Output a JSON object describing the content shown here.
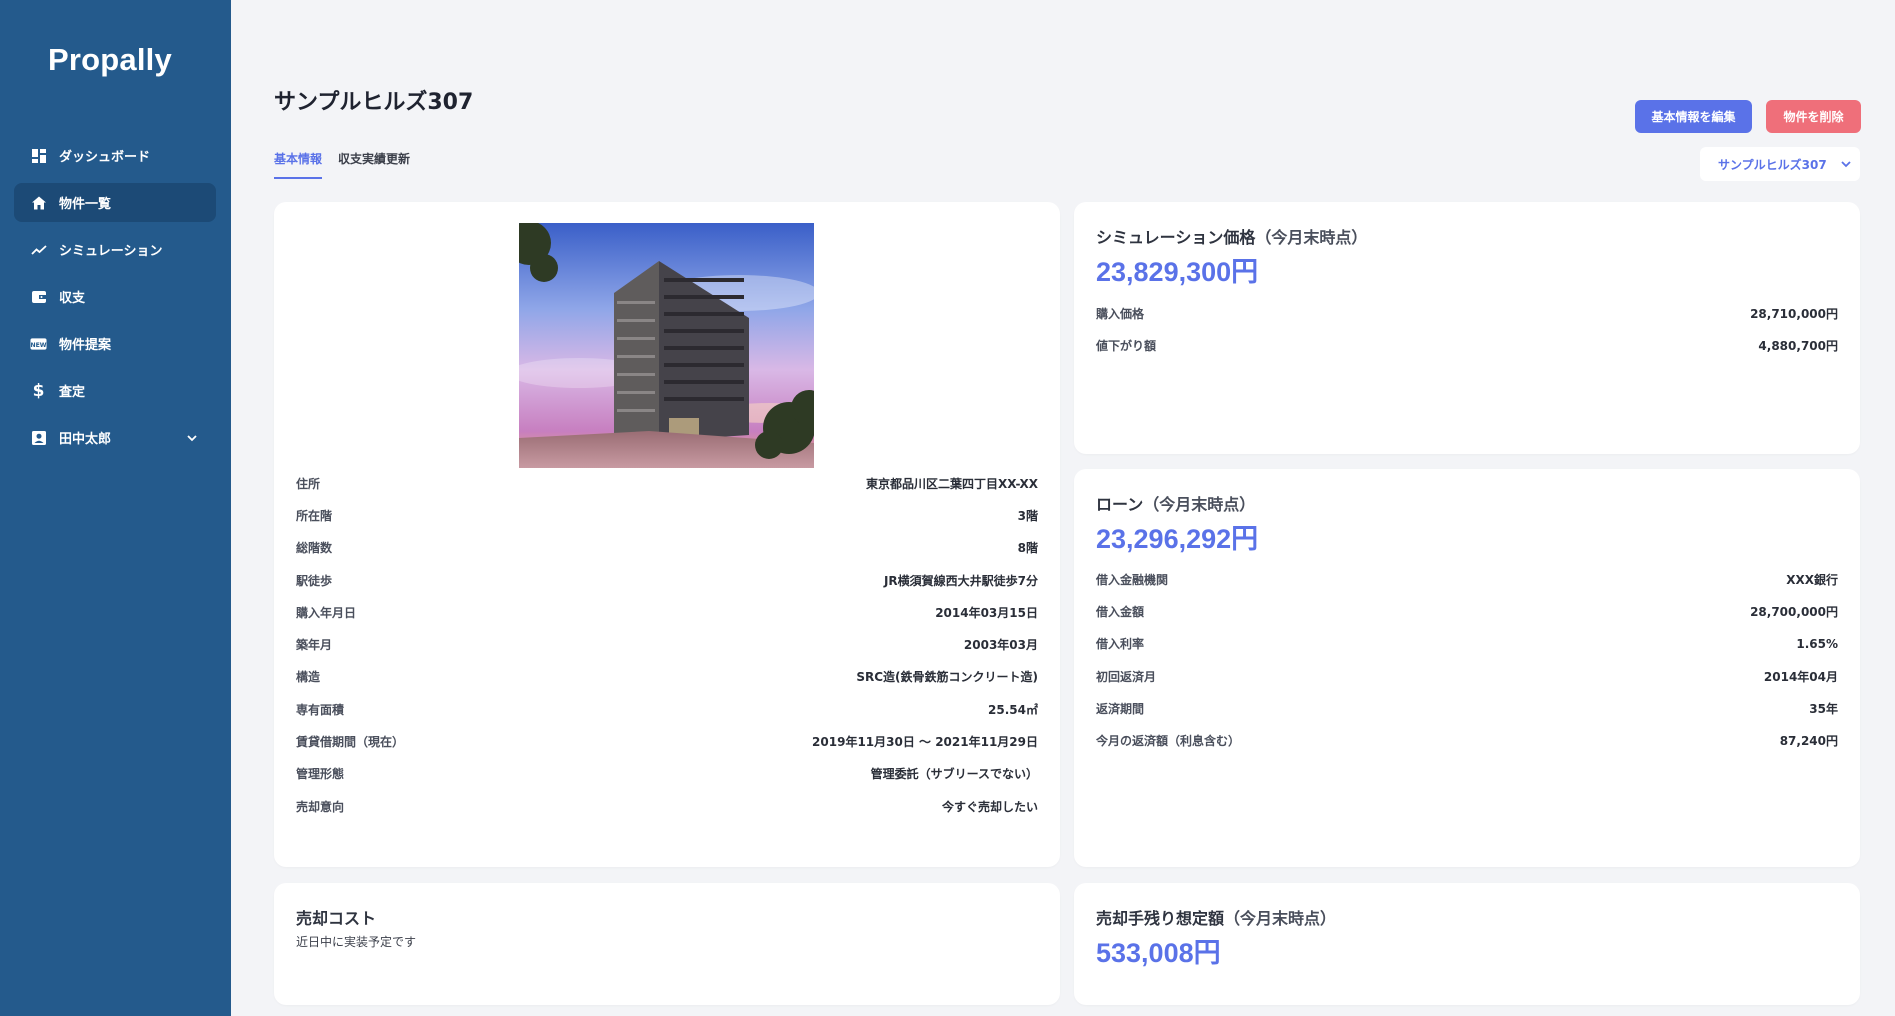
{
  "app": {
    "name": "Propally"
  },
  "sidebar": {
    "items": [
      {
        "label": "ダッシュボード"
      },
      {
        "label": "物件一覧"
      },
      {
        "label": "シミュレーション"
      },
      {
        "label": "収支"
      },
      {
        "label": "物件提案"
      },
      {
        "label": "査定"
      },
      {
        "label": "田中太郎"
      }
    ]
  },
  "page": {
    "title": "サンプルヒルズ307",
    "edit_button": "基本情報を編集",
    "delete_button": "物件を削除",
    "tabs": [
      {
        "label": "基本情報"
      },
      {
        "label": "収支実績更新"
      }
    ],
    "property_select": "サンプルヒルズ307"
  },
  "property": {
    "rows": [
      {
        "label": "住所",
        "value": "東京都品川区二葉四丁目XX-XX"
      },
      {
        "label": "所在階",
        "value": "3階"
      },
      {
        "label": "総階数",
        "value": "8階"
      },
      {
        "label": "駅徒歩",
        "value": "JR横須賀線西大井駅徒歩7分"
      },
      {
        "label": "購入年月日",
        "value": "2014年03月15日"
      },
      {
        "label": "築年月",
        "value": "2003年03月"
      },
      {
        "label": "構造",
        "value": "SRC造(鉄骨鉄筋コンクリート造)"
      },
      {
        "label": "専有面積",
        "value": "25.54㎡"
      },
      {
        "label": "賃貸借期間（現在）",
        "value": "2019年11月30日 〜 2021年11月29日"
      },
      {
        "label": "管理形態",
        "value": "管理委託（サブリースでない）"
      },
      {
        "label": "売却意向",
        "value": "今すぐ売却したい"
      }
    ]
  },
  "simulation": {
    "title": "シミュレーション価格",
    "title_sub": "（今月末時点）",
    "amount": "23,829,300円",
    "rows": [
      {
        "label": "購入価格",
        "value": "28,710,000円"
      },
      {
        "label": "値下がり額",
        "value": "4,880,700円"
      }
    ]
  },
  "loan": {
    "title": "ローン",
    "title_sub": "（今月末時点）",
    "amount": "23,296,292円",
    "rows": [
      {
        "label": "借入金融機関",
        "value": "XXX銀行"
      },
      {
        "label": "借入金額",
        "value": "28,700,000円"
      },
      {
        "label": "借入利率",
        "value": "1.65%"
      },
      {
        "label": "初回返済月",
        "value": "2014年04月"
      },
      {
        "label": "返済期間",
        "value": "35年"
      },
      {
        "label": "今月の返済額（利息含む）",
        "value": "87,240円"
      }
    ]
  },
  "sale_cost": {
    "title": "売却コスト",
    "note": "近日中に実装予定です"
  },
  "remaining": {
    "title": "売却手残り想定額",
    "title_sub": "（今月末時点）",
    "amount": "533,008円"
  },
  "colors": {
    "sidebar": "#245a8c",
    "accent": "#5a72e8",
    "danger": "#ef6f7a"
  }
}
